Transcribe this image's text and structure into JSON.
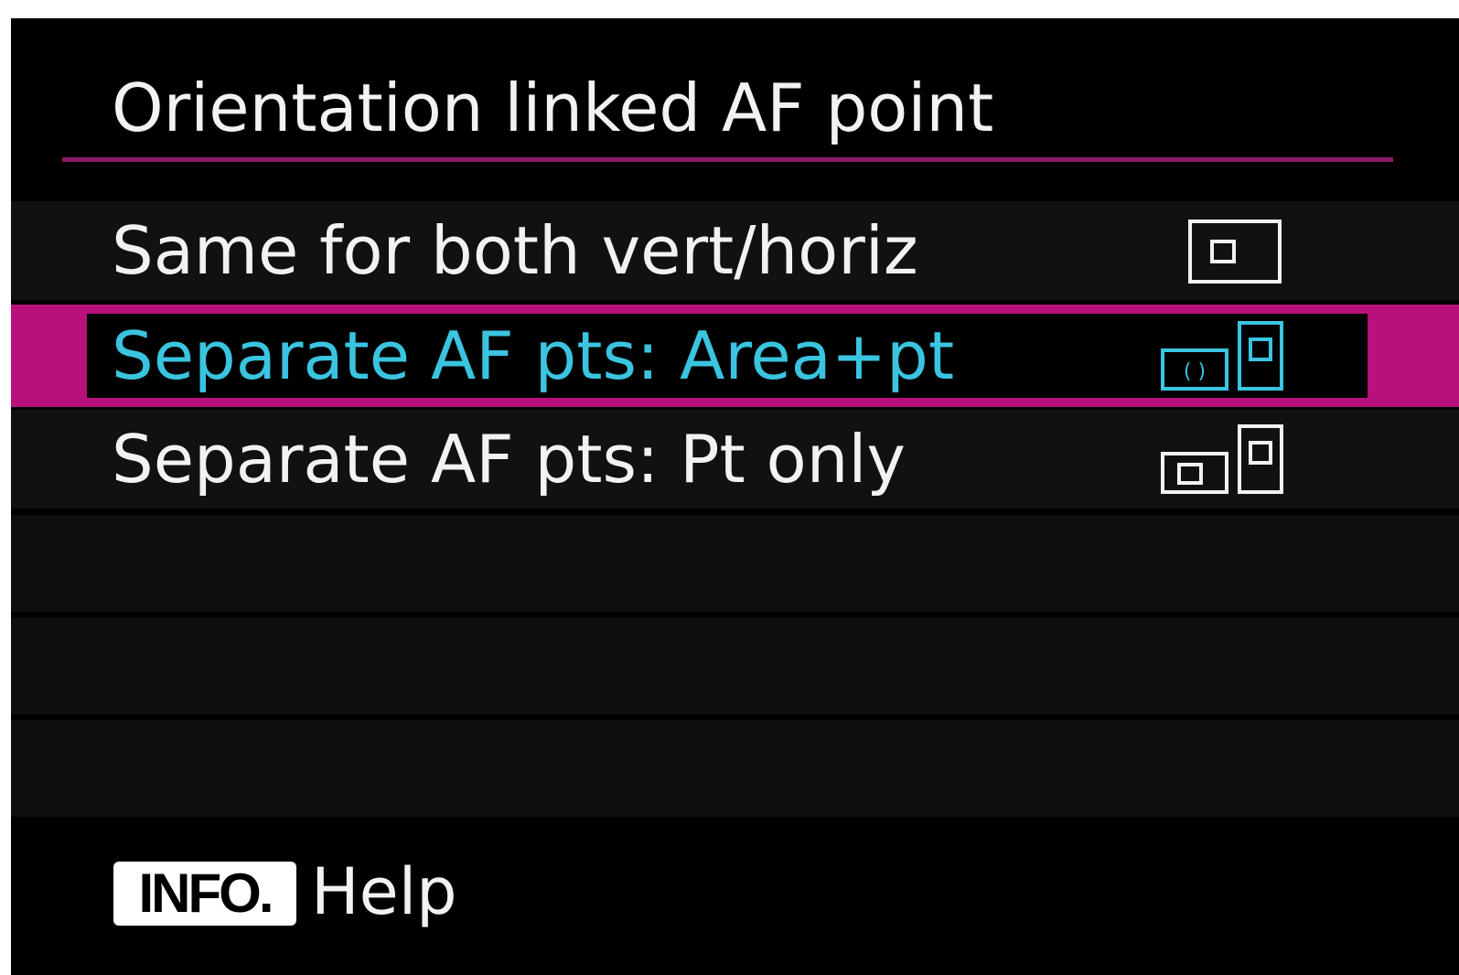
{
  "screen": {
    "title": "Orientation linked AF point",
    "accent_color": "#b8107c",
    "selected_text_color": "#3ac4e0"
  },
  "options": [
    {
      "label": "Same for both vert/horiz",
      "icon": "single-af-point-icon",
      "selected": false
    },
    {
      "label": "Separate AF pts: Area+pt",
      "icon": "separate-area-and-point-icon",
      "selected": true
    },
    {
      "label": "Separate AF pts: Pt only",
      "icon": "separate-point-only-icon",
      "selected": false
    }
  ],
  "footer": {
    "info_button_label": "INFO.",
    "help_label": "Help"
  }
}
